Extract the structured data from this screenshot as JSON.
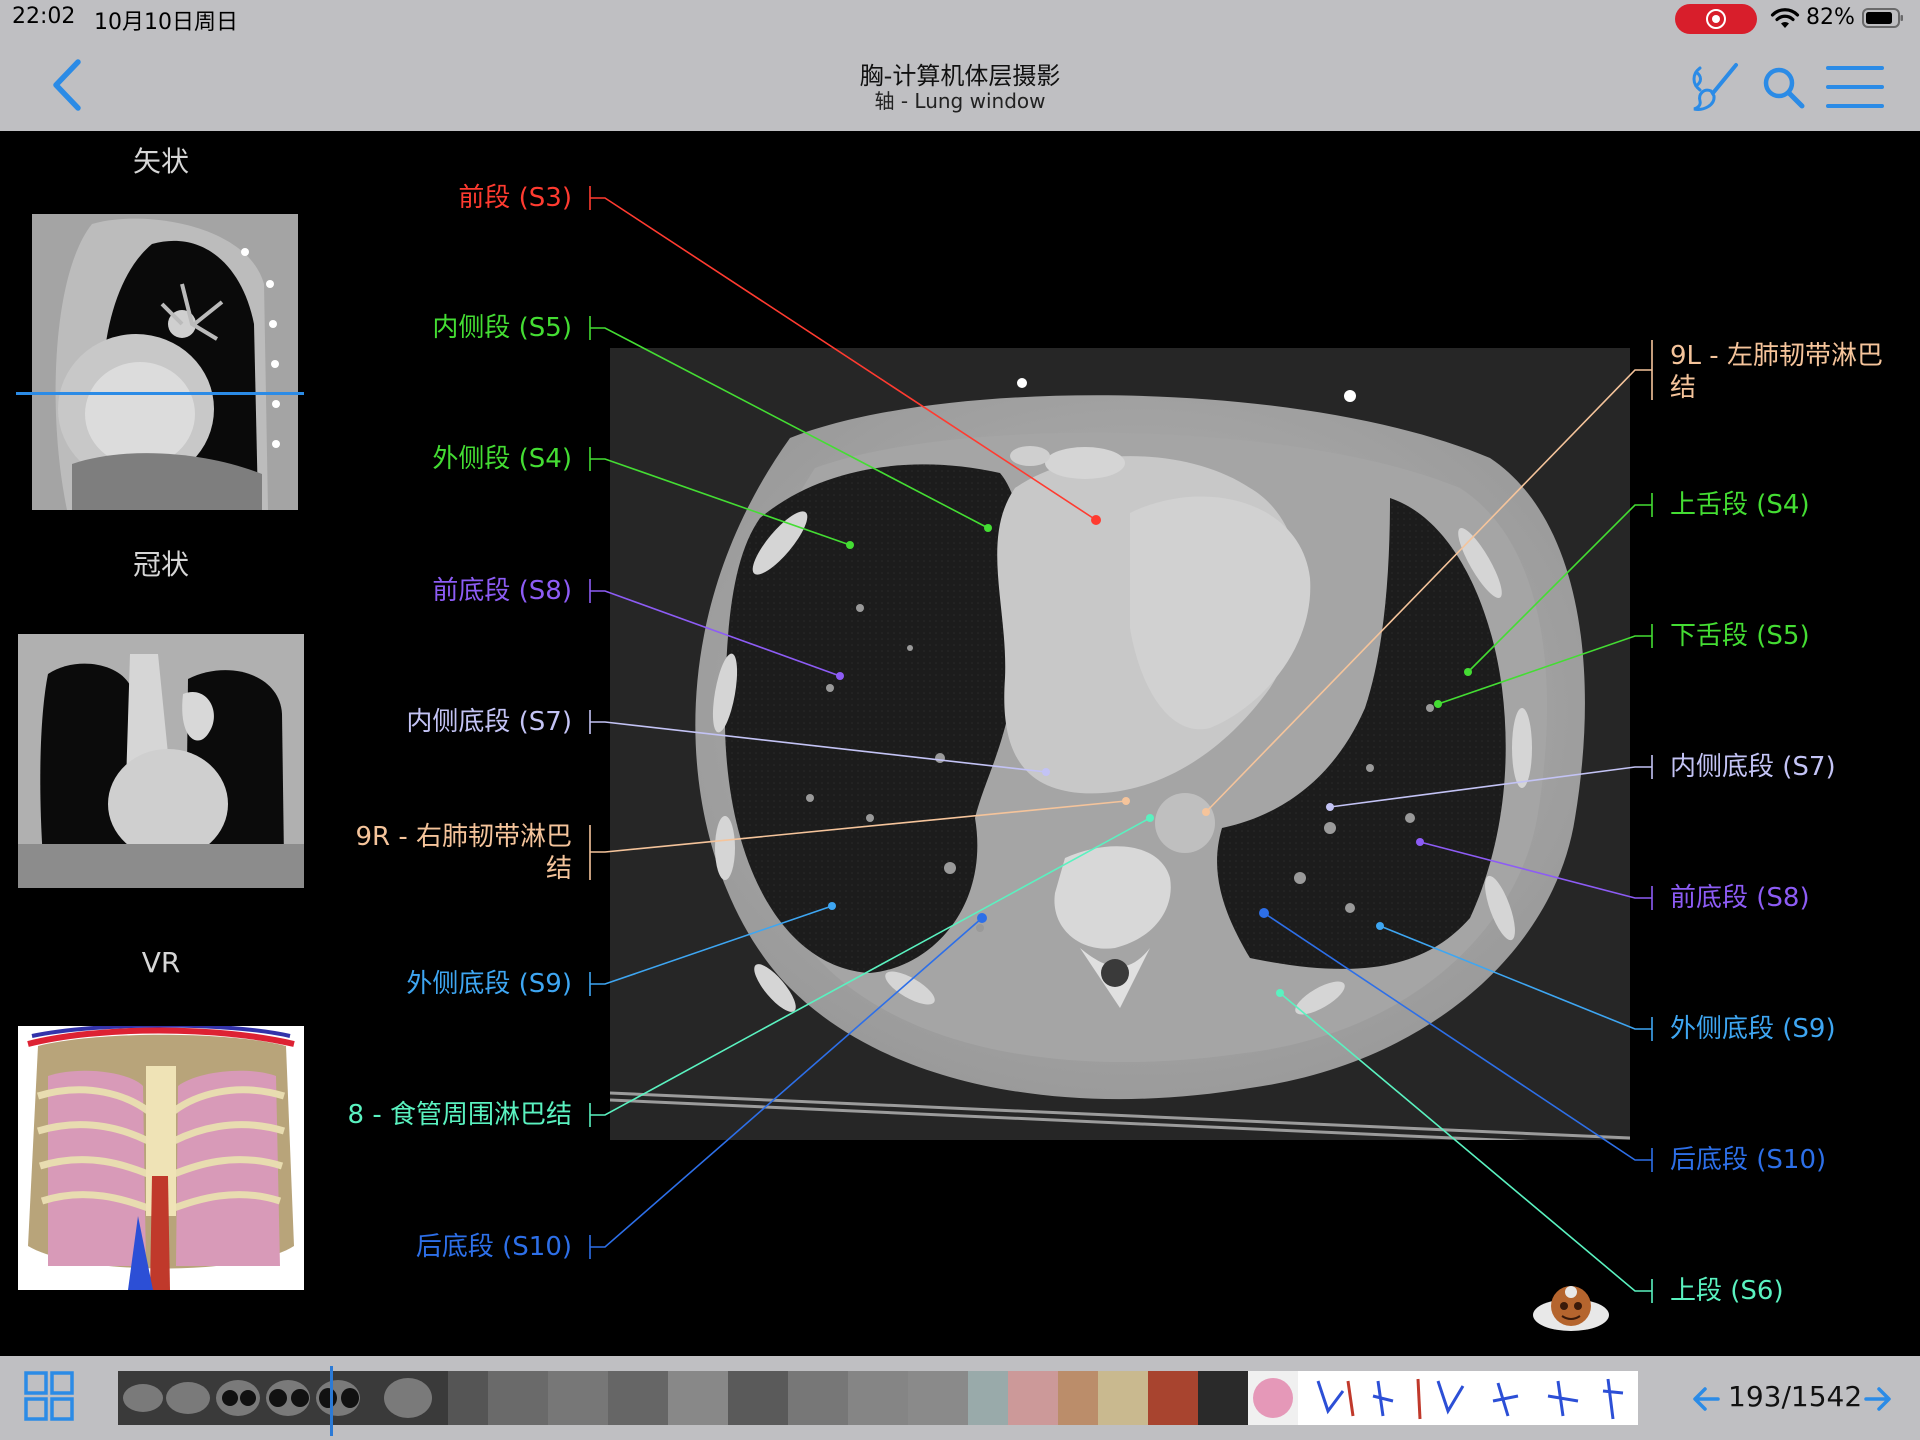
{
  "status": {
    "time": "22:02",
    "date": "10月10日周日",
    "battery": "82%"
  },
  "header": {
    "title": "胸-计算机体层摄影",
    "subtitle": "轴 - Lung window"
  },
  "sidebar": {
    "views": [
      "矢状",
      "冠状",
      "VR"
    ]
  },
  "labels_left": [
    {
      "text": "前段 (S3)",
      "color": "#ff3b30"
    },
    {
      "text": "内侧段 (S5)",
      "color": "#44dd33"
    },
    {
      "text": "外侧段 (S4)",
      "color": "#44dd33"
    },
    {
      "text": "前底段 (S8)",
      "color": "#8d5cf5"
    },
    {
      "text": "内侧底段 (S7)",
      "color": "#c3c3f5"
    },
    {
      "text": "9R - 右肺韧带淋巴",
      "text2": "结",
      "color": "#f5c49b"
    },
    {
      "text": "外侧底段 (S9)",
      "color": "#3ea6f2"
    },
    {
      "text": "8 - 食管周围淋巴结",
      "color": "#5af2c0"
    },
    {
      "text": "后底段 (S10)",
      "color": "#2d6fe8"
    }
  ],
  "labels_right": [
    {
      "text": "9L - 左肺韧带淋巴",
      "text2": "结",
      "color": "#f5c49b"
    },
    {
      "text": "上舌段 (S4)",
      "color": "#44dd33"
    },
    {
      "text": "下舌段 (S5)",
      "color": "#44dd33"
    },
    {
      "text": "内侧底段 (S7)",
      "color": "#c3c3f5"
    },
    {
      "text": "前底段 (S8)",
      "color": "#8d5cf5"
    },
    {
      "text": "外侧底段 (S9)",
      "color": "#3ea6f2"
    },
    {
      "text": "后底段 (S10)",
      "color": "#2d6fe8"
    },
    {
      "text": "上段 (S6)",
      "color": "#5af2c0"
    }
  ],
  "footer": {
    "page": "193/1542"
  }
}
